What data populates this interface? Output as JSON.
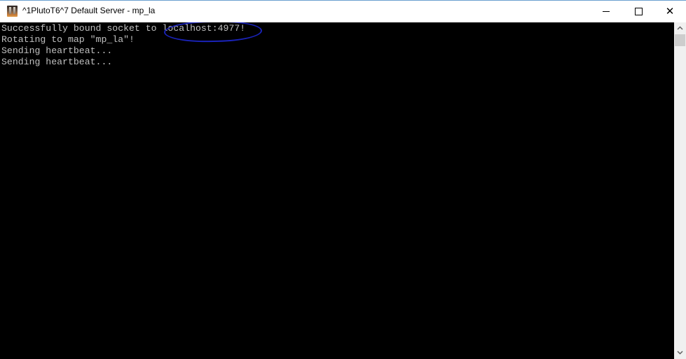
{
  "window": {
    "title": "^1PlutoT6^7 Default Server - mp_la",
    "icon": "pluto-app-icon",
    "controls": {
      "minimize": "minimize-icon",
      "maximize": "maximize-icon",
      "close": "close-icon",
      "close_glyph": "✕"
    }
  },
  "console": {
    "lines": [
      "Successfully bound socket to localhost:4977!",
      "Rotating to map \"mp_la\"!",
      "Sending heartbeat...",
      "Sending heartbeat..."
    ],
    "text_color": "#c0c0c0",
    "background": "#000000",
    "annotation": {
      "circled_text": "localhost:4977!",
      "color": "#1a23b8"
    }
  },
  "scrollbar": {
    "up_glyph": "⌃",
    "down_glyph": "⌄"
  }
}
